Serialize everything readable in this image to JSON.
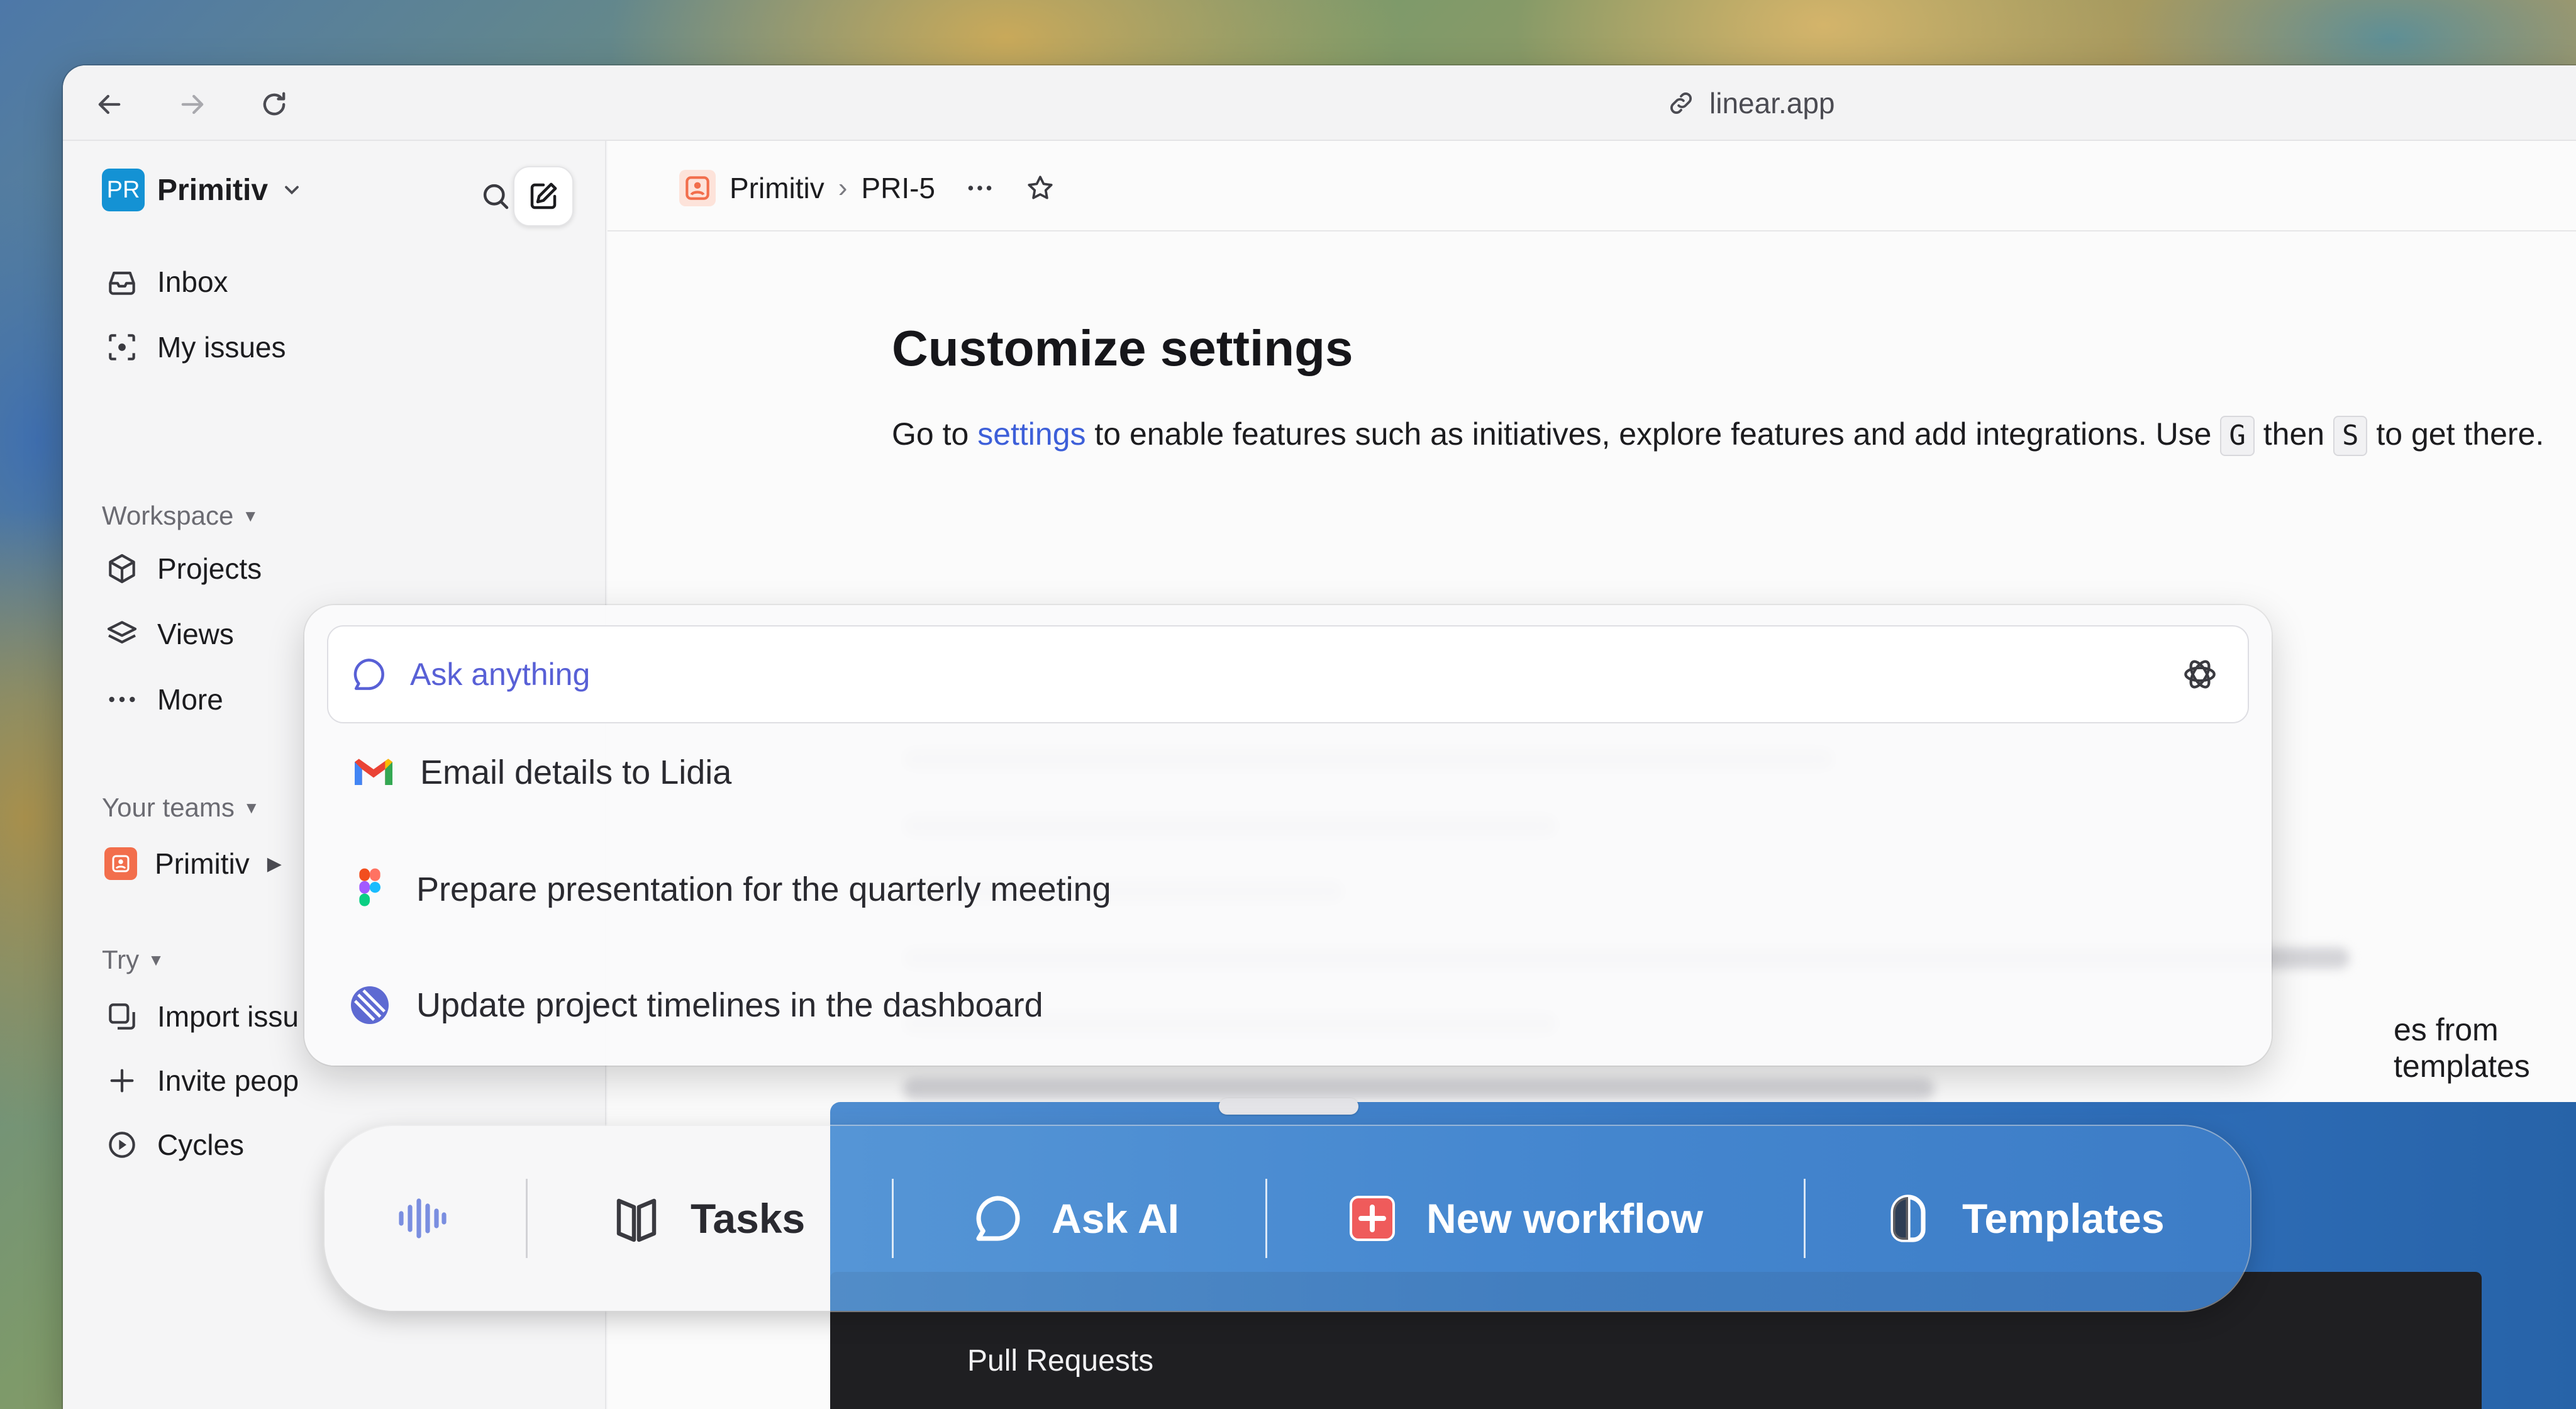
{
  "browser": {
    "url": "linear.app",
    "icons": {
      "back": "arrow-left-icon",
      "forward": "arrow-right-icon",
      "reload": "reload-icon",
      "link": "link-icon"
    }
  },
  "sidebar": {
    "workspace_badge": "PR",
    "workspace_name": "Primitiv",
    "primary_items": [
      {
        "label": "Inbox",
        "icon": "inbox-icon"
      },
      {
        "label": "My issues",
        "icon": "target-icon"
      }
    ],
    "workspace_section": "Workspace",
    "workspace_items": [
      {
        "label": "Projects",
        "icon": "cube-icon"
      },
      {
        "label": "Views",
        "icon": "layers-icon"
      },
      {
        "label": "More",
        "icon": "more-icon"
      }
    ],
    "teams_section": "Your teams",
    "team_name": "Primitiv",
    "try_section": "Try",
    "try_items": [
      {
        "label": "Import issu",
        "icon": "import-icon"
      },
      {
        "label": "Invite peop",
        "icon": "plus-icon"
      },
      {
        "label": "Cycles",
        "icon": "cycles-icon"
      }
    ]
  },
  "header": {
    "breadcrumb_team": "Primitiv",
    "breadcrumb_sep": "›",
    "breadcrumb_issue": "PRI-5"
  },
  "document": {
    "title": "Customize settings",
    "para_before_link": "Go to ",
    "link_text": "settings",
    "para_after_link": " to enable features such as initiatives, explore features and add integrations. Use ",
    "key_g": "G",
    "then_text": " then ",
    "key_s": "S",
    "para_end": " to get there.",
    "visible_fragment": "es from templates"
  },
  "popup": {
    "ask_placeholder": "Ask anything",
    "suggestions": [
      {
        "label": "Email details to Lidia",
        "icon": "gmail-icon"
      },
      {
        "label": "Prepare presentation for the quarterly meeting",
        "icon": "figma-icon"
      },
      {
        "label": "Update project timelines in the dashboard",
        "icon": "linear-icon"
      }
    ]
  },
  "dock": {
    "voice_icon": "voice-waveform-icon",
    "items": [
      {
        "label": "Tasks",
        "icon": "tasks-icon"
      },
      {
        "label": "Ask AI",
        "icon": "chat-bubble-icon"
      },
      {
        "label": "New workflow",
        "icon": "plus-square-icon"
      },
      {
        "label": "Templates",
        "icon": "templates-icon"
      }
    ]
  },
  "background_panel": {
    "label": "Pull Requests"
  },
  "colors": {
    "accent_link": "#3d5fd9",
    "ask_accent": "#5860d6",
    "team_orange": "#f26e4c",
    "workspace_blue": "#1492d4",
    "dock_blue": "#4688d0"
  }
}
